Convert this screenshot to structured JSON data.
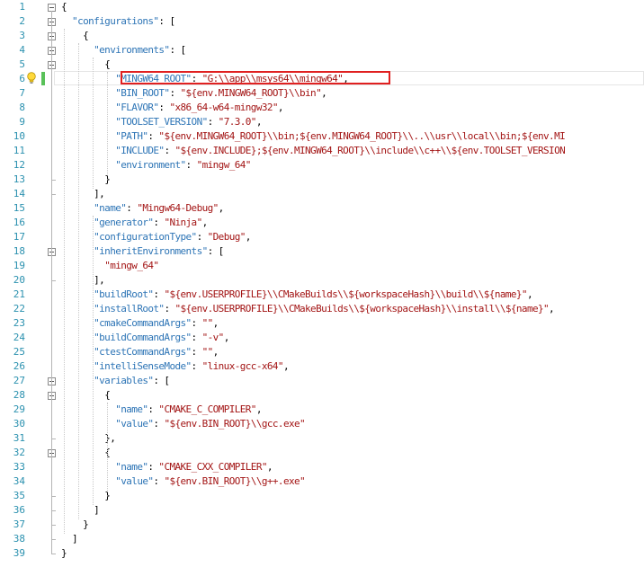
{
  "editor": {
    "lines": [
      {
        "n": "1",
        "indent": "",
        "tokens": [
          [
            "pun",
            "{"
          ]
        ]
      },
      {
        "n": "2",
        "indent": "  ",
        "tokens": [
          [
            "key",
            "\"configurations\""
          ],
          [
            "pun",
            ": ["
          ]
        ]
      },
      {
        "n": "3",
        "indent": "    ",
        "tokens": [
          [
            "pun",
            "{"
          ]
        ]
      },
      {
        "n": "4",
        "indent": "      ",
        "tokens": [
          [
            "key",
            "\"environments\""
          ],
          [
            "pun",
            ": ["
          ]
        ]
      },
      {
        "n": "5",
        "indent": "        ",
        "tokens": [
          [
            "pun",
            "{"
          ]
        ]
      },
      {
        "n": "6",
        "indent": "          ",
        "tokens": [
          [
            "key",
            "\"MINGW64_ROOT\""
          ],
          [
            "pun",
            ": "
          ],
          [
            "str",
            "\"G:\\\\app\\\\msys64\\\\mingw64\""
          ],
          [
            "pun",
            ","
          ]
        ]
      },
      {
        "n": "7",
        "indent": "          ",
        "tokens": [
          [
            "key",
            "\"BIN_ROOT\""
          ],
          [
            "pun",
            ": "
          ],
          [
            "str",
            "\"${env.MINGW64_ROOT}\\\\bin\""
          ],
          [
            "pun",
            ","
          ]
        ]
      },
      {
        "n": "8",
        "indent": "          ",
        "tokens": [
          [
            "key",
            "\"FLAVOR\""
          ],
          [
            "pun",
            ": "
          ],
          [
            "str",
            "\"x86_64-w64-mingw32\""
          ],
          [
            "pun",
            ","
          ]
        ]
      },
      {
        "n": "9",
        "indent": "          ",
        "tokens": [
          [
            "key",
            "\"TOOLSET_VERSION\""
          ],
          [
            "pun",
            ": "
          ],
          [
            "str",
            "\"7.3.0\""
          ],
          [
            "pun",
            ","
          ]
        ]
      },
      {
        "n": "10",
        "indent": "          ",
        "tokens": [
          [
            "key",
            "\"PATH\""
          ],
          [
            "pun",
            ": "
          ],
          [
            "str",
            "\"${env.MINGW64_ROOT}\\\\bin;${env.MINGW64_ROOT}\\\\..\\\\usr\\\\local\\\\bin;${env.MI"
          ]
        ]
      },
      {
        "n": "11",
        "indent": "          ",
        "tokens": [
          [
            "key",
            "\"INCLUDE\""
          ],
          [
            "pun",
            ": "
          ],
          [
            "str",
            "\"${env.INCLUDE};${env.MINGW64_ROOT}\\\\include\\\\c++\\\\${env.TOOLSET_VERSION"
          ]
        ]
      },
      {
        "n": "12",
        "indent": "          ",
        "tokens": [
          [
            "key",
            "\"environment\""
          ],
          [
            "pun",
            ": "
          ],
          [
            "str",
            "\"mingw_64\""
          ]
        ]
      },
      {
        "n": "13",
        "indent": "        ",
        "tokens": [
          [
            "pun",
            "}"
          ]
        ]
      },
      {
        "n": "14",
        "indent": "      ",
        "tokens": [
          [
            "pun",
            "],"
          ]
        ]
      },
      {
        "n": "15",
        "indent": "      ",
        "tokens": [
          [
            "key",
            "\"name\""
          ],
          [
            "pun",
            ": "
          ],
          [
            "str",
            "\"Mingw64-Debug\""
          ],
          [
            "pun",
            ","
          ]
        ]
      },
      {
        "n": "16",
        "indent": "      ",
        "tokens": [
          [
            "key",
            "\"generator\""
          ],
          [
            "pun",
            ": "
          ],
          [
            "str",
            "\"Ninja\""
          ],
          [
            "pun",
            ","
          ]
        ]
      },
      {
        "n": "17",
        "indent": "      ",
        "tokens": [
          [
            "key",
            "\"configurationType\""
          ],
          [
            "pun",
            ": "
          ],
          [
            "str",
            "\"Debug\""
          ],
          [
            "pun",
            ","
          ]
        ]
      },
      {
        "n": "18",
        "indent": "      ",
        "tokens": [
          [
            "key",
            "\"inheritEnvironments\""
          ],
          [
            "pun",
            ": ["
          ]
        ]
      },
      {
        "n": "19",
        "indent": "        ",
        "tokens": [
          [
            "str",
            "\"mingw_64\""
          ]
        ]
      },
      {
        "n": "20",
        "indent": "      ",
        "tokens": [
          [
            "pun",
            "],"
          ]
        ]
      },
      {
        "n": "21",
        "indent": "      ",
        "tokens": [
          [
            "key",
            "\"buildRoot\""
          ],
          [
            "pun",
            ": "
          ],
          [
            "str",
            "\"${env.USERPROFILE}\\\\CMakeBuilds\\\\${workspaceHash}\\\\build\\\\${name}\""
          ],
          [
            "pun",
            ","
          ]
        ]
      },
      {
        "n": "22",
        "indent": "      ",
        "tokens": [
          [
            "key",
            "\"installRoot\""
          ],
          [
            "pun",
            ": "
          ],
          [
            "str",
            "\"${env.USERPROFILE}\\\\CMakeBuilds\\\\${workspaceHash}\\\\install\\\\${name}\""
          ],
          [
            "pun",
            ","
          ]
        ]
      },
      {
        "n": "23",
        "indent": "      ",
        "tokens": [
          [
            "key",
            "\"cmakeCommandArgs\""
          ],
          [
            "pun",
            ": "
          ],
          [
            "str",
            "\"\""
          ],
          [
            "pun",
            ","
          ]
        ]
      },
      {
        "n": "24",
        "indent": "      ",
        "tokens": [
          [
            "key",
            "\"buildCommandArgs\""
          ],
          [
            "pun",
            ": "
          ],
          [
            "str",
            "\"-v\""
          ],
          [
            "pun",
            ","
          ]
        ]
      },
      {
        "n": "25",
        "indent": "      ",
        "tokens": [
          [
            "key",
            "\"ctestCommandArgs\""
          ],
          [
            "pun",
            ": "
          ],
          [
            "str",
            "\"\""
          ],
          [
            "pun",
            ","
          ]
        ]
      },
      {
        "n": "26",
        "indent": "      ",
        "tokens": [
          [
            "key",
            "\"intelliSenseMode\""
          ],
          [
            "pun",
            ": "
          ],
          [
            "str",
            "\"linux-gcc-x64\""
          ],
          [
            "pun",
            ","
          ]
        ]
      },
      {
        "n": "27",
        "indent": "      ",
        "tokens": [
          [
            "key",
            "\"variables\""
          ],
          [
            "pun",
            ": ["
          ]
        ]
      },
      {
        "n": "28",
        "indent": "        ",
        "tokens": [
          [
            "pun",
            "{"
          ]
        ]
      },
      {
        "n": "29",
        "indent": "          ",
        "tokens": [
          [
            "key",
            "\"name\""
          ],
          [
            "pun",
            ": "
          ],
          [
            "str",
            "\"CMAKE_C_COMPILER\""
          ],
          [
            "pun",
            ","
          ]
        ]
      },
      {
        "n": "30",
        "indent": "          ",
        "tokens": [
          [
            "key",
            "\"value\""
          ],
          [
            "pun",
            ": "
          ],
          [
            "str",
            "\"${env.BIN_ROOT}\\\\gcc.exe\""
          ]
        ]
      },
      {
        "n": "31",
        "indent": "        ",
        "tokens": [
          [
            "pun",
            "},"
          ]
        ]
      },
      {
        "n": "32",
        "indent": "        ",
        "tokens": [
          [
            "pun",
            "{"
          ]
        ]
      },
      {
        "n": "33",
        "indent": "          ",
        "tokens": [
          [
            "key",
            "\"name\""
          ],
          [
            "pun",
            ": "
          ],
          [
            "str",
            "\"CMAKE_CXX_COMPILER\""
          ],
          [
            "pun",
            ","
          ]
        ]
      },
      {
        "n": "34",
        "indent": "          ",
        "tokens": [
          [
            "key",
            "\"value\""
          ],
          [
            "pun",
            ": "
          ],
          [
            "str",
            "\"${env.BIN_ROOT}\\\\g++.exe\""
          ]
        ]
      },
      {
        "n": "35",
        "indent": "        ",
        "tokens": [
          [
            "pun",
            "}"
          ]
        ]
      },
      {
        "n": "36",
        "indent": "      ",
        "tokens": [
          [
            "pun",
            "]"
          ]
        ]
      },
      {
        "n": "37",
        "indent": "    ",
        "tokens": [
          [
            "pun",
            "}"
          ]
        ]
      },
      {
        "n": "38",
        "indent": "  ",
        "tokens": [
          [
            "pun",
            "]"
          ]
        ]
      },
      {
        "n": "39",
        "indent": "",
        "tokens": [
          [
            "pun",
            "}"
          ]
        ]
      }
    ],
    "colors": {
      "key": "#2e75b6",
      "string": "#a31515",
      "line_number": "#2b91af",
      "highlight_box": "#e02020",
      "modified_bar": "#59c159"
    },
    "icons": {
      "lightbulb": "lightbulb-icon",
      "fold": "collapse-icon"
    }
  }
}
